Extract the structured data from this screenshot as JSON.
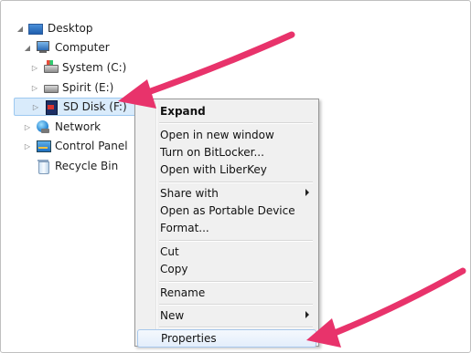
{
  "tree": {
    "items": [
      {
        "label": "Desktop",
        "icon": "desktop-icon"
      },
      {
        "label": "Computer",
        "icon": "computer-icon"
      },
      {
        "label": "System (C:)",
        "icon": "hard-drive-icon"
      },
      {
        "label": "Spirit (E:)",
        "icon": "removable-drive-icon"
      },
      {
        "label": "SD Disk (F:)",
        "icon": "sd-card-icon"
      },
      {
        "label": "Network",
        "icon": "network-icon"
      },
      {
        "label": "Control Panel",
        "icon": "control-panel-icon"
      },
      {
        "label": "Recycle Bin",
        "icon": "recycle-bin-icon"
      }
    ]
  },
  "context_menu": {
    "items": [
      {
        "label": "Expand"
      },
      {
        "label": "Open in new window"
      },
      {
        "label": "Turn on BitLocker..."
      },
      {
        "label": "Open with LiberKey"
      },
      {
        "label": "Share with"
      },
      {
        "label": "Open as Portable Device"
      },
      {
        "label": "Format..."
      },
      {
        "label": "Cut"
      },
      {
        "label": "Copy"
      },
      {
        "label": "Rename"
      },
      {
        "label": "New"
      },
      {
        "label": "Properties"
      }
    ]
  },
  "colors": {
    "selection": "#d9ebfb",
    "arrow": "#e8336b",
    "menu_background": "#f0f0f0"
  }
}
